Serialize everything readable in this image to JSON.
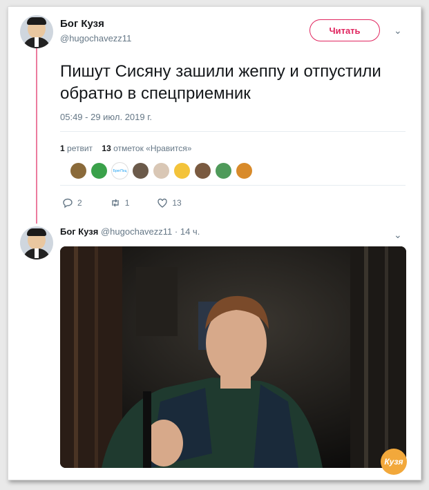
{
  "tweet": {
    "author_name": "Бог Кузя",
    "author_handle": "@hugochavezz11",
    "follow_label": "Читать",
    "text": "Пишут Сисяну зашили жеппу и отпустили обратно в спецприемник",
    "timestamp": "05:49 - 29 июл. 2019 г.",
    "retweets_count": "1",
    "retweets_label": "ретвит",
    "likes_count": "13",
    "likes_label": "отметок «Нравится»",
    "actions": {
      "replies": "2",
      "retweets": "1",
      "likes": "13"
    },
    "liker_colors": [
      "#8a6a3a",
      "#3aa14a",
      "#1da1f2",
      "#6b5a4a",
      "#d9c7b5",
      "#f3c33a",
      "#7a5a40",
      "#4f9a5a",
      "#d88a2a"
    ],
    "liker_badge_text": "БрегПоц"
  },
  "reply": {
    "author_name": "Бог Кузя",
    "author_handle": "@hugochavezz11",
    "time": "· 14 ч."
  },
  "watermark": "Кузя",
  "colors": {
    "accent": "#e0245e",
    "muted": "#657786",
    "divider": "#e6ecf0"
  }
}
